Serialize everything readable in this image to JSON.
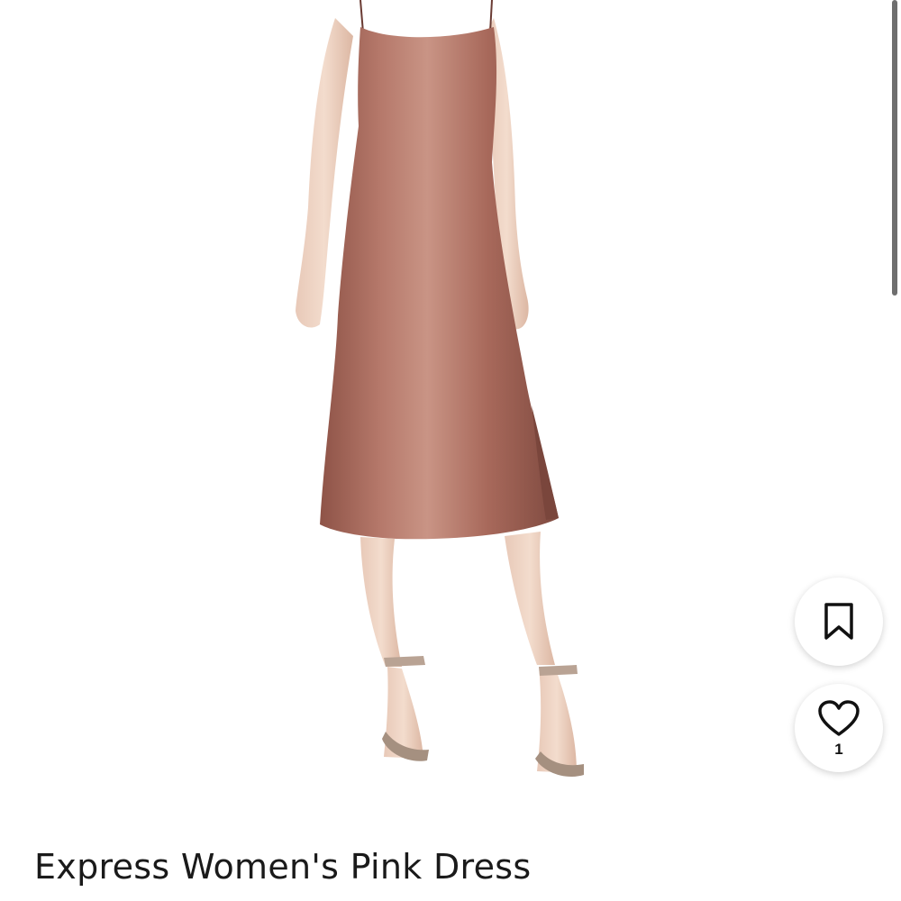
{
  "listing": {
    "title": "Express Women's Pink Dress",
    "image_subject": "pink satin slip midi dress on model"
  },
  "actions": {
    "save_icon": "bookmark-icon",
    "like_icon": "heart-icon",
    "like_count": "1"
  },
  "colors": {
    "dress": "#a86a5e",
    "dress_highlight": "#c48a7c",
    "background": "#ffffff",
    "icon": "#111111"
  }
}
